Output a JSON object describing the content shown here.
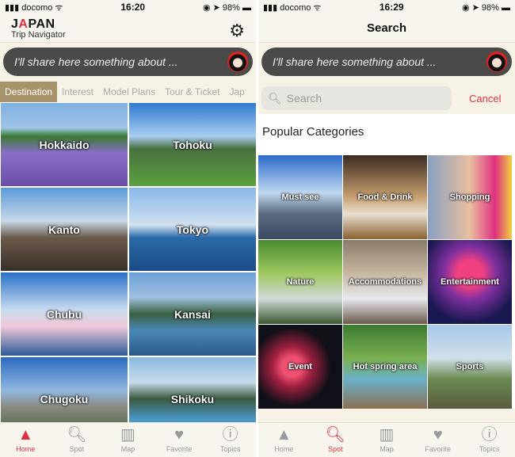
{
  "left": {
    "status": {
      "carrier": "docomo",
      "time": "16:20",
      "battery": "98%"
    },
    "logo": {
      "line1_a": "J",
      "line1_b": "A",
      "line1_c": "PAN",
      "line2": "Trip Navigator"
    },
    "share_text": "I'll share here something about ...",
    "tabs": [
      "Destination",
      "Interest",
      "Model Plans",
      "Tour & Ticket",
      "Jap"
    ],
    "regions": [
      "Hokkaido",
      "Tohoku",
      "Kanto",
      "Tokyo",
      "Chubu",
      "Kansai",
      "Chugoku",
      "Shikoku"
    ],
    "tabbar": [
      "Home",
      "Spot",
      "Map",
      "Favorite",
      "Topics"
    ]
  },
  "right": {
    "status": {
      "carrier": "docomo",
      "time": "16:29",
      "battery": "98%"
    },
    "title": "Search",
    "share_text": "I'll share here something about ...",
    "search_placeholder": "Search",
    "cancel": "Cancel",
    "popular": "Popular Categories",
    "categories": [
      "Must see",
      "Food & Drink",
      "Shopping",
      "Nature",
      "Accommodations",
      "Entertainment",
      "Event",
      "Hot spring area",
      "Sports"
    ],
    "tabbar": [
      "Home",
      "Spot",
      "Map",
      "Favorite",
      "Topics"
    ]
  },
  "colors": {
    "accent": "#e03040",
    "tab_active": "#a8946a"
  }
}
